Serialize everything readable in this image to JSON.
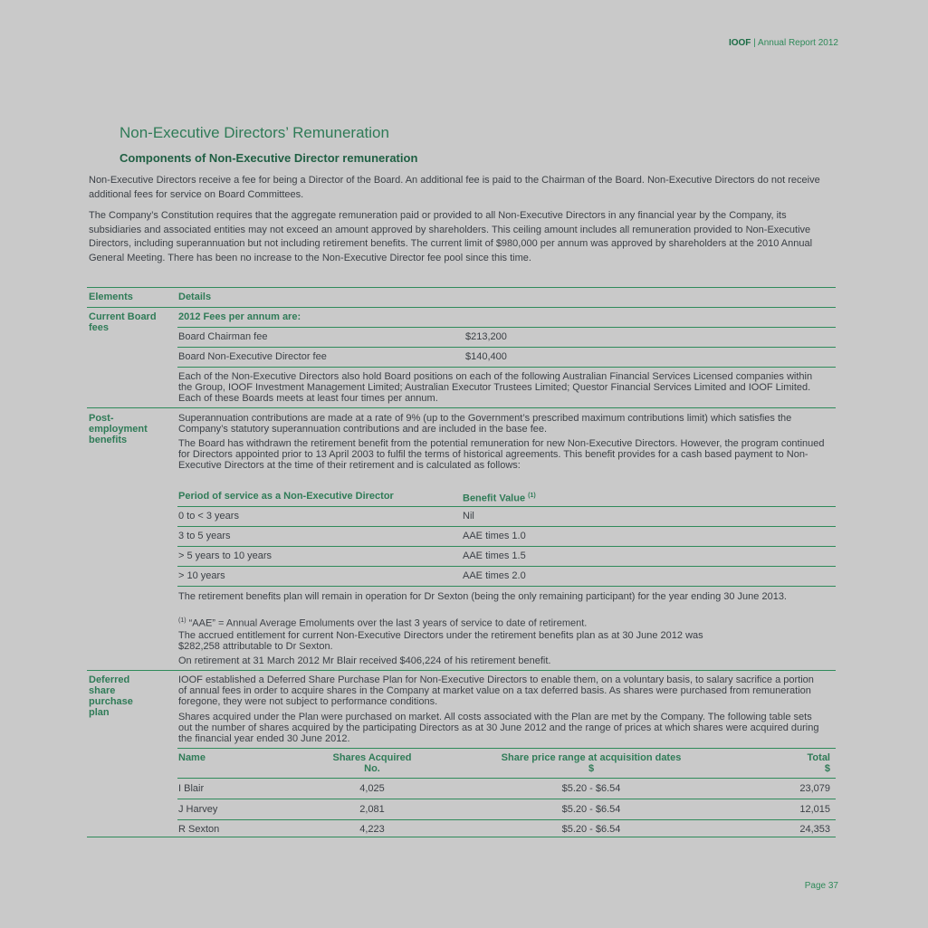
{
  "header": {
    "org": "IOOF",
    "separator": " | ",
    "report": "Annual Report 2012"
  },
  "title": "Non-Executive Directors’ Remuneration",
  "subtitle": "Components of Non-Executive Director remuneration",
  "paragraph1": "Non-Executive Directors receive a fee for being a Director of the Board. An additional fee is paid to the Chairman of the Board. Non-Executive Directors do not receive additional fees for service on Board Committees.",
  "paragraph2": "The Company’s Constitution requires that the aggregate remuneration paid or provided to all Non-Executive Directors in any financial year by the Company, its subsidiaries and associated entities may not exceed an amount approved by shareholders. This ceiling amount includes all remuneration provided to Non-Executive Directors, including superannuation but not including retirement benefits. The current limit of $980,000 per annum was approved by shareholders at the 2010 Annual General Meeting. There has been no increase to the Non-Executive Director fee pool since this time.",
  "table": {
    "col_elements": "Elements",
    "col_details": "Details",
    "board_fees": {
      "label": "Current Board fees",
      "heading": "2012 Fees per annum are:",
      "rows": [
        {
          "name": "Board Chairman fee",
          "value": "$213,200"
        },
        {
          "name": "Board Non-Executive Director fee",
          "value": "$140,400"
        }
      ],
      "note": "Each of the Non-Executive Directors also hold Board positions on each of the following Australian Financial Services Licensed companies within the Group, IOOF Investment Management Limited; Australian Executor Trustees Limited; Questor Financial Services Limited and IOOF Limited. Each of these Boards meets at least four times per annum."
    },
    "post_employment": {
      "label": "Post-employment benefits",
      "text1": "Superannuation contributions are made at a rate of 9% (up to the Government’s prescribed maximum contributions limit) which satisfies the Company’s statutory superannuation contributions and are included in the base fee.",
      "text2": "The Board has withdrawn the retirement benefit from the potential remuneration for new Non-Executive Directors. However, the program continued for Directors appointed prior to 13 April 2003 to fulfil the terms of historical agreements. This benefit provides for a cash based payment to Non-Executive Directors at the time of their retirement and is calculated as follows:",
      "col_period": "Period of service as a Non-Executive Director",
      "col_benefit": "Benefit Value",
      "col_benefit_sup": "(1)",
      "rows": [
        {
          "period": "0 to < 3 years",
          "benefit": "Nil"
        },
        {
          "period": "3 to 5 years",
          "benefit": "AAE times 1.0"
        },
        {
          "period": "> 5 years to 10 years",
          "benefit": "AAE times 1.5"
        },
        {
          "period": "> 10 years",
          "benefit": "AAE times 2.0"
        }
      ],
      "text3": "The retirement benefits plan will remain in operation for Dr Sexton (being the only remaining participant) for the year ending 30 June 2013.",
      "footnote_mark": "(1)",
      "footnote": " “AAE” = Annual Average Emoluments over the last 3 years of service to date of retirement.",
      "text4": "The accrued entitlement for current Non-Executive Directors under the retirement benefits plan as at 30 June 2012 was $282,258 attributable to Dr Sexton.",
      "text5": "On retirement at 31 March 2012 Mr Blair received $406,224 of his retirement benefit."
    },
    "deferred": {
      "label": "Deferred share purchase plan",
      "text1": "IOOF established a Deferred Share Purchase Plan for Non-Executive Directors to enable them, on a voluntary basis, to salary sacrifice a portion of annual fees in order to acquire shares in the Company at market value on a tax deferred basis. As shares were purchased from remuneration foregone, they were not subject to performance conditions.",
      "text2": "Shares acquired under the Plan were purchased on market. All costs associated with the Plan are met by the Company. The following table sets out the number of shares acquired by the participating Directors as at 30 June 2012 and the range of prices at which shares were acquired during the financial year ended 30 June 2012.",
      "col_name": "Name",
      "col_shares": "Shares Acquired",
      "col_shares2": "No.",
      "col_price": "Share price range at acquisition dates",
      "col_price2": "$",
      "col_total": "Total",
      "col_total2": "$",
      "rows": [
        {
          "name": "I Blair",
          "shares": "4,025",
          "price": "$5.20 - $6.54",
          "total": "23,079"
        },
        {
          "name": "J Harvey",
          "shares": "2,081",
          "price": "$5.20 - $6.54",
          "total": "12,015"
        },
        {
          "name": "R Sexton",
          "shares": "4,223",
          "price": "$5.20 - $6.54",
          "total": "24,353"
        }
      ]
    }
  },
  "footer": "Page 37"
}
